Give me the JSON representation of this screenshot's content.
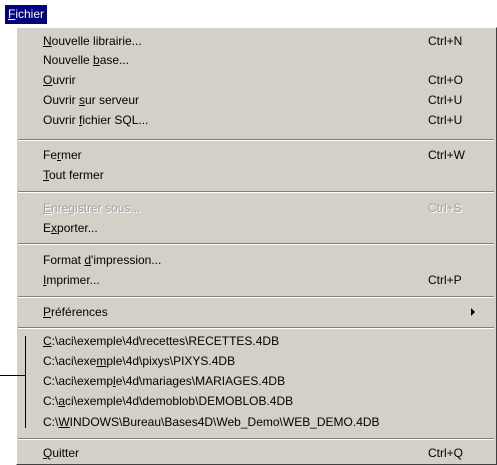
{
  "menubar": {
    "title": [
      "",
      "F",
      "ichier"
    ]
  },
  "menu": {
    "nouvelle_librairie": {
      "parts": [
        "",
        "N",
        "ouvelle librairie..."
      ],
      "shortcut": "Ctrl+N"
    },
    "nouvelle_base": {
      "parts": [
        "Nouvelle ",
        "b",
        "ase..."
      ],
      "shortcut": ""
    },
    "ouvrir": {
      "parts": [
        "",
        "O",
        "uvrir"
      ],
      "shortcut": "Ctrl+O"
    },
    "ouvrir_serveur": {
      "parts": [
        "Ouvrir ",
        "s",
        "ur serveur"
      ],
      "shortcut": "Ctrl+U"
    },
    "ouvrir_sql": {
      "parts": [
        "Ouvrir ",
        "f",
        "ichier SQL..."
      ],
      "shortcut": "Ctrl+U"
    },
    "fermer": {
      "parts": [
        "Fe",
        "r",
        "mer"
      ],
      "shortcut": "Ctrl+W"
    },
    "tout_fermer": {
      "parts": [
        "",
        "T",
        "out fermer"
      ],
      "shortcut": ""
    },
    "enregistrer": {
      "parts": [
        "",
        "E",
        "nregistrer sous..."
      ],
      "shortcut": "Ctrl+S"
    },
    "exporter": {
      "parts": [
        "E",
        "x",
        "porter..."
      ],
      "shortcut": ""
    },
    "format": {
      "parts": [
        "Format ",
        "d",
        "'impression..."
      ],
      "shortcut": ""
    },
    "imprimer": {
      "parts": [
        "",
        "I",
        "mprimer..."
      ],
      "shortcut": "Ctrl+P"
    },
    "preferences": {
      "parts": [
        "",
        "P",
        "références"
      ],
      "shortcut": ""
    },
    "recent1": {
      "parts": [
        "",
        "C",
        ":\\aci\\exemple\\4d\\recettes\\RECETTES.4DB"
      ]
    },
    "recent2": {
      "parts": [
        "C:\\aci\\exe",
        "m",
        "ple\\4d\\pixys\\PIXYS.4DB"
      ]
    },
    "recent3": {
      "parts": [
        "C:\\aci\\exemp",
        "l",
        "e\\4d\\mariages\\MARIAGES.4DB"
      ]
    },
    "recent4": {
      "parts": [
        "C:\\",
        "a",
        "ci\\exemple\\4d\\demoblob\\DEMOBLOB.4DB"
      ]
    },
    "recent5": {
      "parts": [
        "C:\\",
        "W",
        "INDOWS\\Bureau\\Bases4D\\Web_Demo\\WEB_DEMO.4DB"
      ]
    },
    "quitter": {
      "parts": [
        "",
        "Q",
        "uitter"
      ],
      "shortcut": "Ctrl+Q"
    }
  }
}
